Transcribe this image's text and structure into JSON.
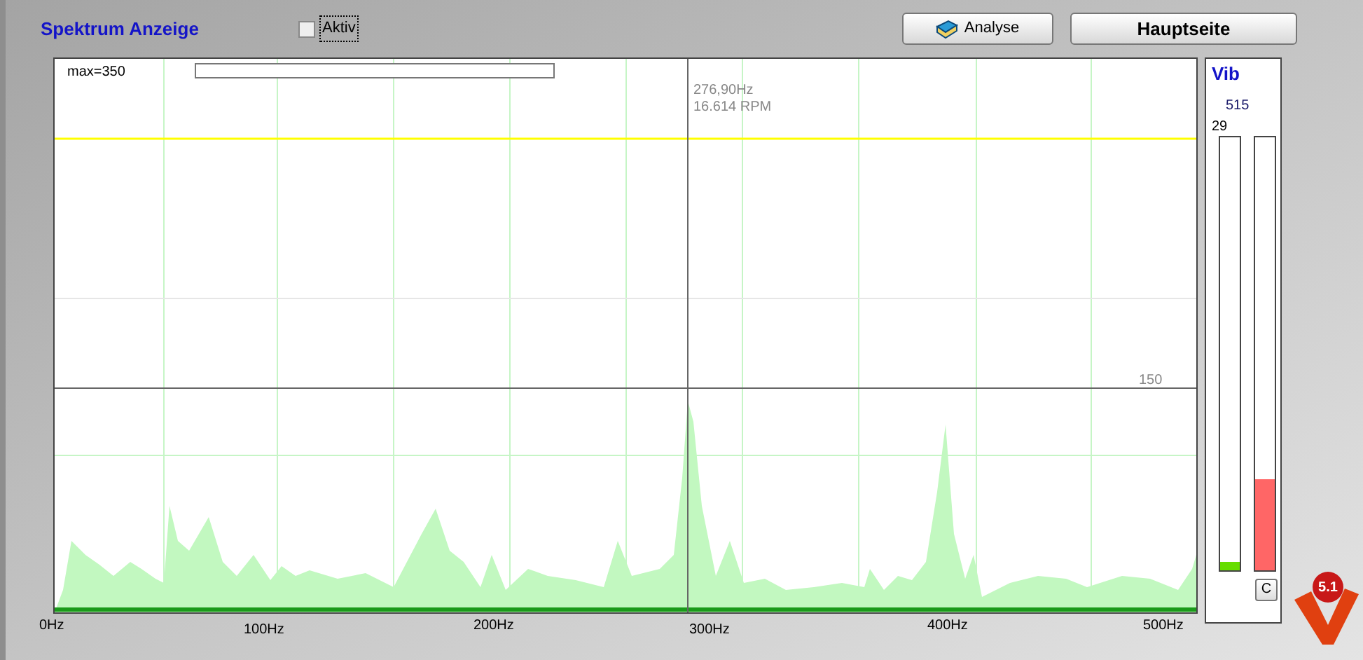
{
  "title": "Spektrum Anzeige",
  "aktiv": {
    "label": "Aktiv",
    "checked": false
  },
  "buttons": [
    {
      "kind": "icon",
      "label": "Analyse"
    },
    {
      "kind": "bold",
      "label": "Hauptseite"
    }
  ],
  "spectrum": {
    "max_label": "max=350",
    "cursor_frequency": "276,90Hz",
    "cursor_rpm": "16.614 RPM",
    "threshold_label": "150",
    "x_labels": [
      "0Hz",
      "100Hz",
      "200Hz",
      "300Hz",
      "400Hz",
      "500Hz"
    ]
  },
  "vib": {
    "title": "Vib",
    "value": "515",
    "bars": [
      {
        "reading": "29",
        "level": 0.02,
        "color": "#66dd00"
      },
      {
        "level": 0.21,
        "color": "#ff6666"
      }
    ],
    "clear_button": "C"
  },
  "logo_text": "5.1"
}
